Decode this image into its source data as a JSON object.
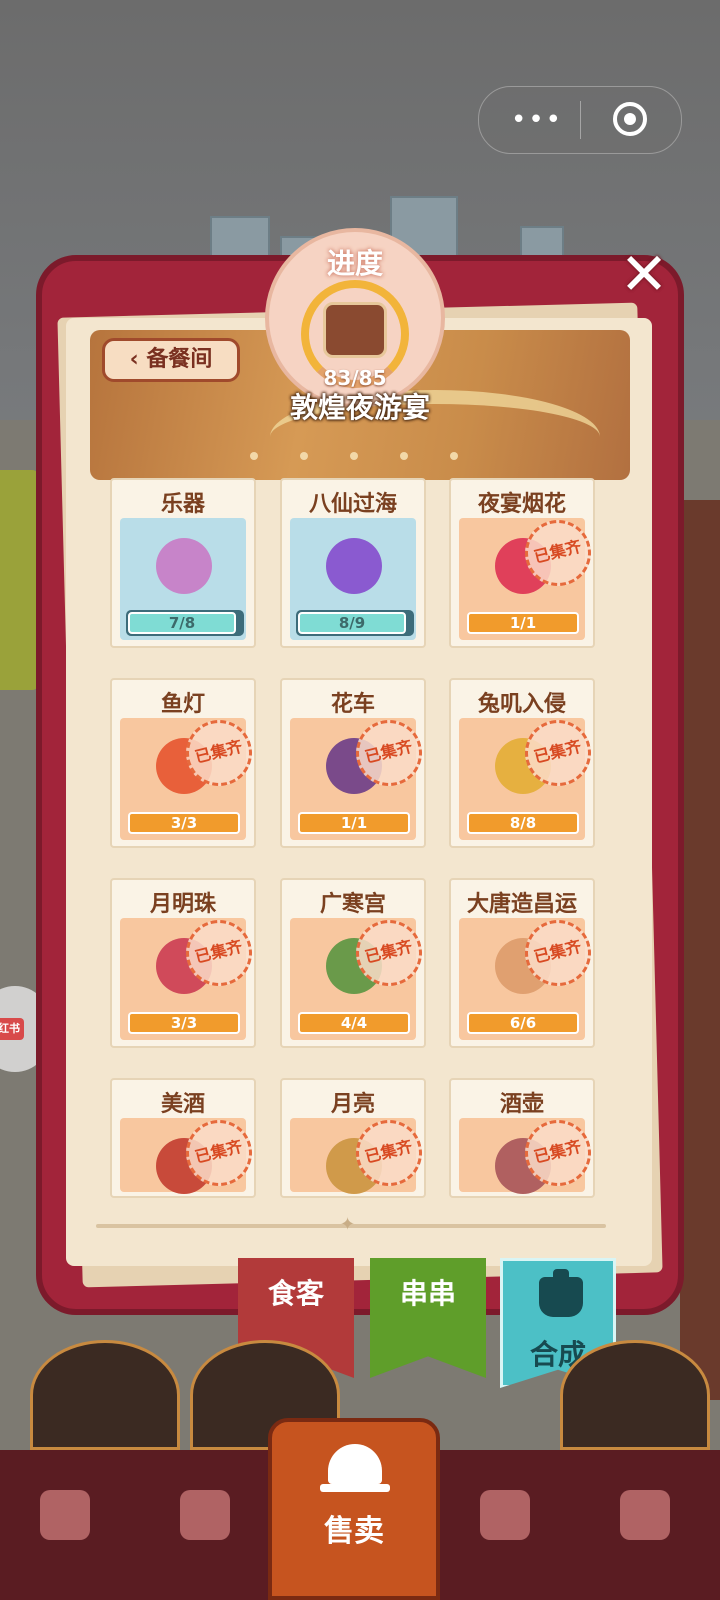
{
  "miniprogram_capsule": {
    "more_icon": "•••",
    "close_icon": "target-circle-icon"
  },
  "progress": {
    "title": "进度",
    "count": "83/85"
  },
  "event_title": "敦煌夜游宴",
  "back_button": "备餐间",
  "close_icon": "✕",
  "stamp_text": "已集齐",
  "items": [
    {
      "name": "乐器",
      "progress": "7/8",
      "collected": false
    },
    {
      "name": "八仙过海",
      "progress": "8/9",
      "collected": false
    },
    {
      "name": "夜宴烟花",
      "progress": "1/1",
      "collected": true
    },
    {
      "name": "鱼灯",
      "progress": "3/3",
      "collected": true
    },
    {
      "name": "花车",
      "progress": "1/1",
      "collected": true
    },
    {
      "name": "兔叽入侵",
      "progress": "8/8",
      "collected": true
    },
    {
      "name": "月明珠",
      "progress": "3/3",
      "collected": true
    },
    {
      "name": "广寒宫",
      "progress": "4/4",
      "collected": true
    },
    {
      "name": "大唐造昌运",
      "progress": "6/6",
      "collected": true
    },
    {
      "name": "美酒",
      "progress": "",
      "collected": true
    },
    {
      "name": "月亮",
      "progress": "",
      "collected": true
    },
    {
      "name": "酒壶",
      "progress": "",
      "collected": true
    }
  ],
  "tabs": {
    "diners": "食客",
    "skewers": "串串",
    "craft": "合成"
  },
  "bottom_nav": {
    "sell": "售卖"
  },
  "side_bubble": "红书",
  "colors": {
    "frame": "#a2243a",
    "collected_bar": "#f19b2c",
    "incomplete_bar": "#7fdcd4",
    "stamp": "#d84a22"
  }
}
